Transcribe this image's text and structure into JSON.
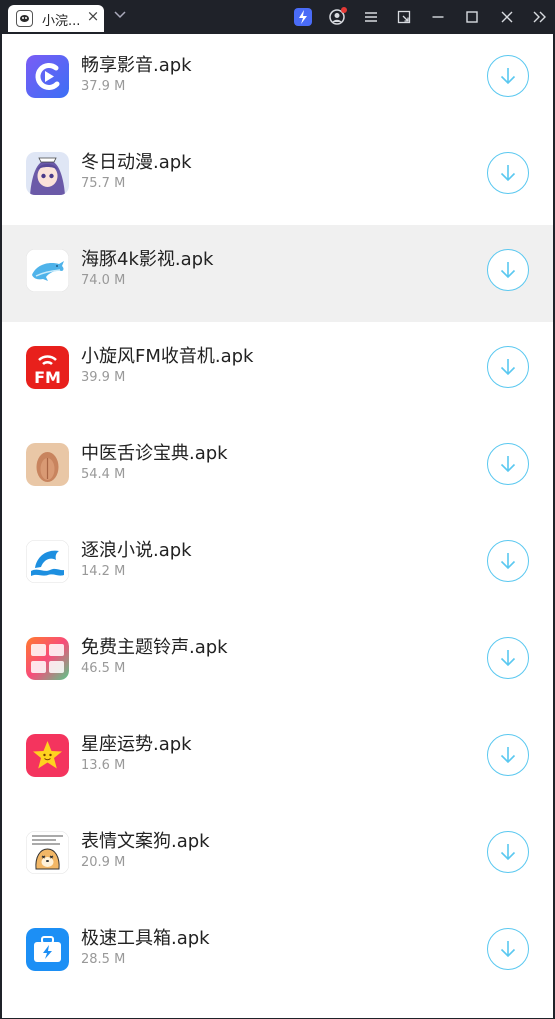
{
  "window": {
    "tab_title": "小浣..."
  },
  "icons": {
    "tab_close": "close-icon",
    "tab_dropdown": "chevron-down-icon",
    "boost": "lightning-icon",
    "account": "user-icon",
    "menu": "menu-icon",
    "shrink": "shrink-window-icon",
    "minimize": "minimize-icon",
    "maximize": "maximize-icon",
    "close": "close-icon",
    "collapse": "double-chevron-right-icon",
    "download": "download-arrow-icon"
  },
  "colors": {
    "accent": "#5ac8f0",
    "highlight_row": "#f0f0f0"
  },
  "apps": [
    {
      "name": "畅享影音.apk",
      "size": "37.9 M",
      "icon": "play-circle-icon"
    },
    {
      "name": "冬日动漫.apk",
      "size": "75.7 M",
      "icon": "anime-girl-icon"
    },
    {
      "name": "海豚4k影视.apk",
      "size": "74.0 M",
      "icon": "dolphin-icon",
      "selected": true
    },
    {
      "name": "小旋风FM收音机.apk",
      "size": "39.9 M",
      "icon": "fm-radio-icon"
    },
    {
      "name": "中医舌诊宝典.apk",
      "size": "54.4 M",
      "icon": "tongue-icon"
    },
    {
      "name": "逐浪小说.apk",
      "size": "14.2 M",
      "icon": "dolphin-wave-icon"
    },
    {
      "name": "免费主题铃声.apk",
      "size": "46.5 M",
      "icon": "free-ringtone-icon"
    },
    {
      "name": "星座运势.apk",
      "size": "13.6 M",
      "icon": "star-icon"
    },
    {
      "name": "表情文案狗.apk",
      "size": "20.9 M",
      "icon": "meme-dog-icon"
    },
    {
      "name": "极速工具箱.apk",
      "size": "28.5 M",
      "icon": "toolbox-icon"
    }
  ]
}
